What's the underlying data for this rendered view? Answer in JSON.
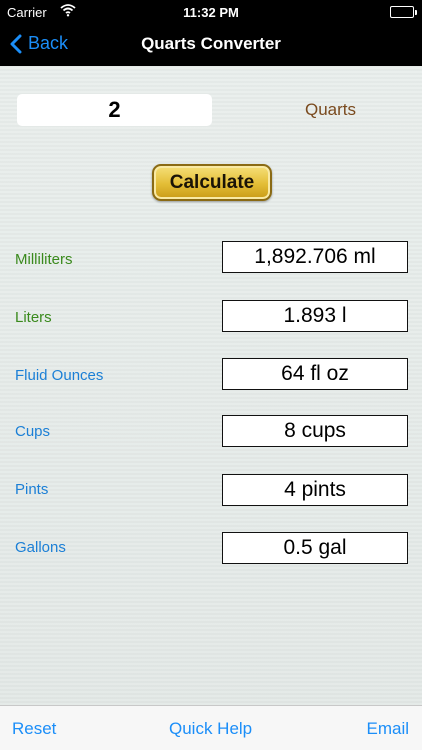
{
  "status_bar": {
    "carrier": "Carrier",
    "time": "11:32 PM"
  },
  "nav": {
    "back_label": "Back",
    "title": "Quarts Converter"
  },
  "input": {
    "value": "2",
    "unit": "Quarts"
  },
  "calculate_label": "Calculate",
  "results": [
    {
      "label": "Milliliters",
      "value": "1,892.706 ml",
      "color": "#3a8a1d"
    },
    {
      "label": "Liters",
      "value": "1.893 l",
      "color": "#3a8a1d"
    },
    {
      "label": "Fluid Ounces",
      "value": "64 fl oz",
      "color": "#1b7fd6"
    },
    {
      "label": "Cups",
      "value": "8 cups",
      "color": "#1b7fd6"
    },
    {
      "label": "Pints",
      "value": "4 pints",
      "color": "#1b7fd6"
    },
    {
      "label": "Gallons",
      "value": "0.5 gal",
      "color": "#1b7fd6"
    }
  ],
  "toolbar": {
    "reset": "Reset",
    "help": "Quick Help",
    "email": "Email"
  },
  "colors": {
    "accent": "#1b8ef8",
    "unit_label": "#7a4a1e",
    "button_gold": "#e3bd36"
  }
}
